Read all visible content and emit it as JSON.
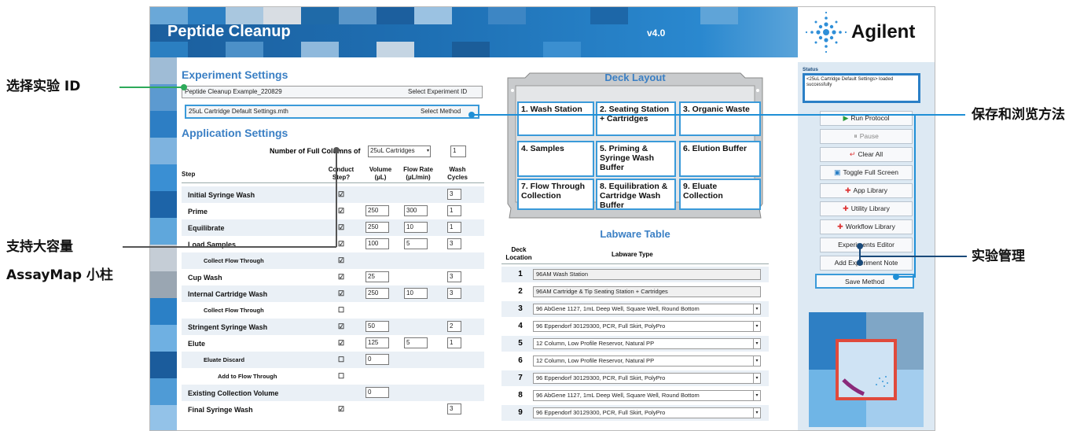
{
  "app": {
    "title": "Peptide Cleanup",
    "version": "v4.0",
    "brand": "Agilent"
  },
  "callouts": {
    "select_id": "选择实验 ID",
    "save_browse": "保存和浏览方法",
    "capacity_line1": "支持大容量",
    "capacity_line2": "AssayMap 小柱",
    "exp_mgmt": "实验管理"
  },
  "experiment": {
    "title": "Experiment Settings",
    "experiment_id": "Peptide Cleanup Example_220829",
    "select_id_label": "Select Experiment ID",
    "method": "25uL Cartridge Default Settings.mth",
    "select_method_label": "Select Method"
  },
  "application": {
    "title": "Application Settings",
    "num_columns_label": "Number of Full Columns of",
    "cartridge_type": "25uL Cartridges",
    "num_columns_value": "1",
    "headers": {
      "step": "Step",
      "conduct": "Conduct Step?",
      "volume": "Volume (µL)",
      "flow": "Flow Rate (µL/min)",
      "wash": "Wash Cycles"
    },
    "steps": [
      {
        "label": "Initial Syringe Wash",
        "checked": "☑",
        "volume": "",
        "flow": "",
        "wash": "3"
      },
      {
        "label": "Prime",
        "checked": "☑",
        "volume": "250",
        "flow": "300",
        "wash": "1"
      },
      {
        "label": "Equilibrate",
        "checked": "☑",
        "volume": "250",
        "flow": "10",
        "wash": "1"
      },
      {
        "label": "Load Samples",
        "checked": "☑",
        "volume": "100",
        "flow": "5",
        "wash": "3"
      },
      {
        "label": "Collect Flow Through",
        "checked": "☑",
        "volume": "",
        "flow": "",
        "wash": ""
      },
      {
        "label": "Cup Wash",
        "checked": "☑",
        "volume": "25",
        "flow": "",
        "wash": "3"
      },
      {
        "label": "Internal Cartridge Wash",
        "checked": "☑",
        "volume": "250",
        "flow": "10",
        "wash": "3"
      },
      {
        "label": "Collect Flow Through",
        "checked": "☐",
        "volume": "",
        "flow": "",
        "wash": ""
      },
      {
        "label": "Stringent Syringe Wash",
        "checked": "☑",
        "volume": "50",
        "flow": "",
        "wash": "2"
      },
      {
        "label": "Elute",
        "checked": "☑",
        "volume": "125",
        "flow": "5",
        "wash": "1"
      },
      {
        "label": "Eluate Discard",
        "checked": "☐",
        "volume": "0",
        "flow": "",
        "wash": ""
      },
      {
        "label": "Add to Flow Through",
        "checked": "☐",
        "volume": "",
        "flow": "",
        "wash": ""
      },
      {
        "label": "Existing Collection Volume",
        "checked": "",
        "volume": "0",
        "flow": "",
        "wash": ""
      },
      {
        "label": "Final Syringe Wash",
        "checked": "☑",
        "volume": "",
        "flow": "",
        "wash": "3"
      }
    ]
  },
  "deck": {
    "title": "Deck Layout",
    "positions": [
      "1. Wash Station",
      "2. Seating Station + Cartridges",
      "3. Organic Waste",
      "4. Samples",
      "5. Priming & Syringe Wash Buffer",
      "6. Elution Buffer",
      "7. Flow Through Collection",
      "8. Equilibration & Cartridge Wash Buffer",
      "9. Eluate Collection"
    ]
  },
  "labware": {
    "title": "Labware Table",
    "col_location": "Deck Location",
    "col_type": "Labware Type",
    "rows": [
      {
        "num": "1",
        "type": "96AM Wash Station"
      },
      {
        "num": "2",
        "type": "96AM Cartridge & Tip Seating Station + Cartridges"
      },
      {
        "num": "3",
        "type": "96 AbGene 1127, 1mL Deep Well, Square Well, Round Bottom"
      },
      {
        "num": "4",
        "type": "96 Eppendorf 30129300, PCR, Full Skirt, PolyPro"
      },
      {
        "num": "5",
        "type": "12 Column, Low Profile Reservor, Natural PP"
      },
      {
        "num": "6",
        "type": "12 Column, Low Profile Reservor, Natural PP"
      },
      {
        "num": "7",
        "type": "96 Eppendorf 30129300, PCR, Full Skirt, PolyPro"
      },
      {
        "num": "8",
        "type": "96 AbGene 1127, 1mL Deep Well, Square Well, Round Bottom"
      },
      {
        "num": "9",
        "type": "96 Eppendorf 30129300, PCR, Full Skirt, PolyPro"
      }
    ]
  },
  "status": {
    "label": "Status",
    "message": "<25uL Cartridge Default Settings> loaded successfully"
  },
  "controls": {
    "run": "Run Protocol",
    "pause": "Pause",
    "clear": "Clear All",
    "fullscreen": "Toggle Full Screen",
    "app_library": "App Library",
    "utility_library": "Utility Library",
    "workflow_library": "Workflow Library",
    "exp_editor": "Experiments Editor",
    "add_note": "Add Experiment Note",
    "save_method": "Save Method"
  },
  "colors": {
    "accent": "#3a9ad9",
    "header": "#3a7fc4",
    "callout_green": "#2eaa5a",
    "callout_blue": "#1f8fd6",
    "callout_dark": "#1a4a7a"
  }
}
